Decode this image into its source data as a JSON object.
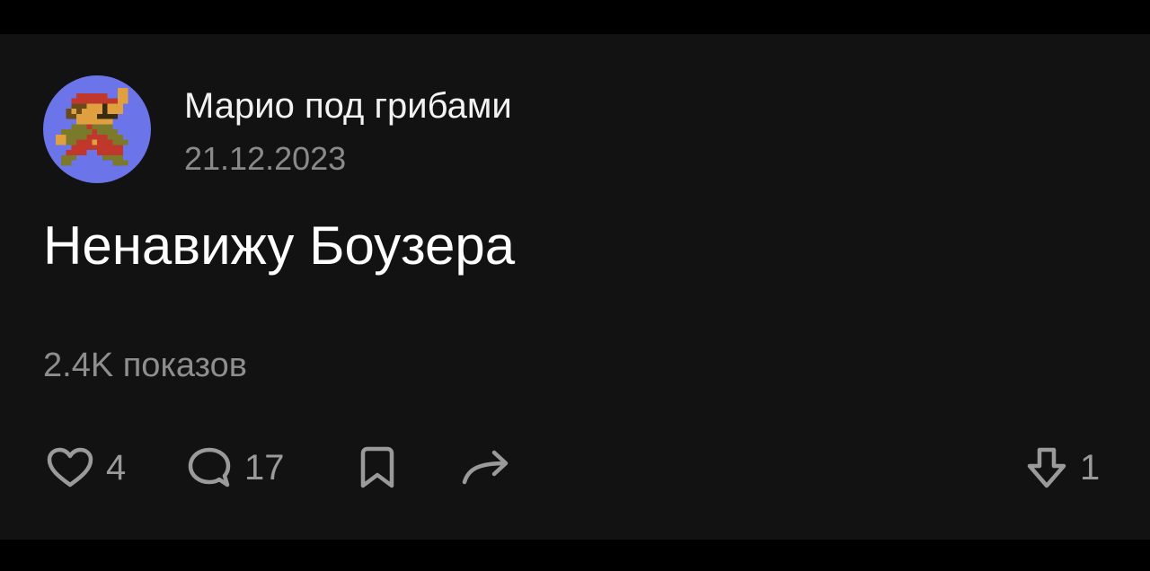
{
  "post": {
    "author": "Марио под грибами",
    "date": "21.12.2023",
    "text": "Ненавижу Боузера",
    "views": "2.4K показов"
  },
  "actions": {
    "likes": "4",
    "comments": "17",
    "downvotes": "1"
  },
  "icons": {
    "like": "heart-icon",
    "comment": "comment-bubble-icon",
    "bookmark": "bookmark-icon",
    "share": "share-arrow-icon",
    "downvote": "arrow-down-icon"
  },
  "colors": {
    "background": "#121212",
    "avatar_bg": "#6b74e8",
    "text_primary": "#ffffff",
    "text_secondary": "#8e8e8e"
  }
}
